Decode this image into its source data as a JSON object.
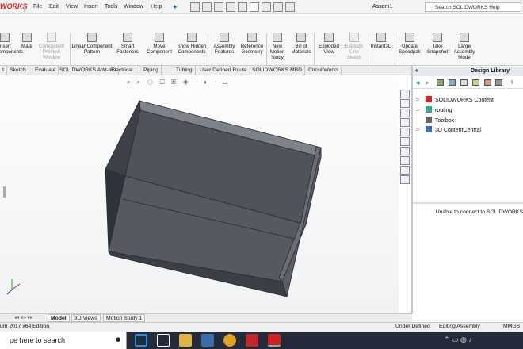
{
  "app": {
    "logo": "WORKS",
    "doc_title": "Assem1"
  },
  "menu": [
    "File",
    "Edit",
    "View",
    "Insert",
    "Tools",
    "Window",
    "Help"
  ],
  "search": {
    "placeholder": "Search SOLIDWORKS Help"
  },
  "commands": [
    {
      "label": "Insert Components",
      "disabled": false,
      "icon": "insert-components-icon"
    },
    {
      "label": "Mate",
      "disabled": false,
      "icon": "mate-icon"
    },
    {
      "label": "Component Preview Window",
      "disabled": true,
      "icon": "preview-window-icon"
    },
    {
      "label": "Linear Component Pattern",
      "disabled": false,
      "icon": "pattern-icon"
    },
    {
      "label": "Smart Fasteners",
      "disabled": false,
      "icon": "fastener-icon"
    },
    {
      "label": "Move Component",
      "disabled": false,
      "icon": "move-icon"
    },
    {
      "label": "Show Hidden Components",
      "disabled": false,
      "icon": "show-hidden-icon"
    },
    {
      "label": "Assembly Features",
      "disabled": false,
      "icon": "assembly-features-icon"
    },
    {
      "label": "Reference Geometry",
      "disabled": false,
      "icon": "reference-geometry-icon"
    },
    {
      "label": "New Motion Study",
      "disabled": false,
      "icon": "motion-study-icon"
    },
    {
      "label": "Bill of Materials",
      "disabled": false,
      "icon": "bom-icon"
    },
    {
      "label": "Exploded View",
      "disabled": false,
      "icon": "exploded-view-icon"
    },
    {
      "label": "Explode Line Sketch",
      "disabled": true,
      "icon": "explode-line-icon"
    },
    {
      "label": "Instant3D",
      "disabled": false,
      "icon": "instant3d-icon"
    },
    {
      "label": "Update Speedpak",
      "disabled": false,
      "icon": "speedpak-icon"
    },
    {
      "label": "Take Snapshot",
      "disabled": false,
      "icon": "snapshot-icon"
    },
    {
      "label": "Large Assembly Mode",
      "disabled": false,
      "icon": "large-assembly-icon"
    }
  ],
  "tabs": [
    "t",
    "Sketch",
    "Evaluate",
    "SOLIDWORKS Add-Ins",
    "Electrical",
    "Piping",
    "Tubing",
    "User Defined Route",
    "SOLIDWORKS MBD",
    "CircuitWorks"
  ],
  "design_library": {
    "title": "Design Library",
    "items": [
      {
        "label": "SOLIDWORKS Content",
        "icon": "solidworks-content-icon",
        "expander": ">"
      },
      {
        "label": "routing",
        "icon": "routing-icon",
        "expander": ">"
      },
      {
        "label": "Toolbox",
        "icon": "toolbox-icon",
        "expander": ""
      },
      {
        "label": "3D ContentCentral",
        "icon": "globe-icon",
        "expander": ">"
      }
    ],
    "message": "Unable to connect to SOLIDWORKS"
  },
  "bottom_tabs": [
    "Model",
    "3D Views",
    "Motion Study 1"
  ],
  "status": {
    "left": "um 2017 x64 Edition",
    "under_defined": "Under Defined",
    "mode": "Editing Assembly",
    "units": "MMGS"
  },
  "taskbar": {
    "search": "pe here to search"
  },
  "colors": {
    "solidworks_red": "#d22020",
    "model_face": "#4f535c",
    "taskbar": "#232b3a"
  }
}
